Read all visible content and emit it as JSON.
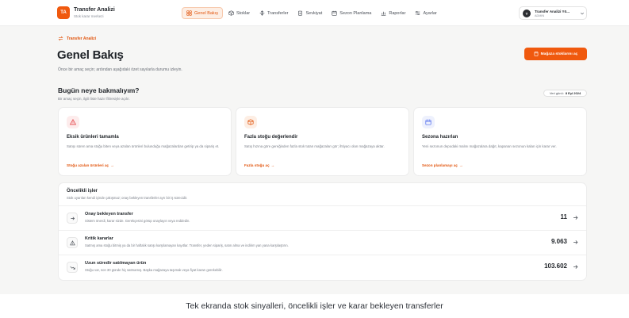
{
  "app": {
    "logo_text": "TA",
    "name": "Transfer Analizi",
    "subtitle": "Stok karar merkezi",
    "accent_color": "#f0590e"
  },
  "nav": [
    {
      "label": "Genel Bakış",
      "icon": "grid-icon",
      "active": true
    },
    {
      "label": "Stoklar",
      "icon": "box-icon",
      "active": false
    },
    {
      "label": "Transferler",
      "icon": "arrows-icon",
      "active": false
    },
    {
      "label": "Sevkiyat",
      "icon": "clipboard-icon",
      "active": false
    },
    {
      "label": "Sezon Planlama",
      "icon": "calendar-icon",
      "active": false
    },
    {
      "label": "Raporlar",
      "icon": "bar-chart-icon",
      "active": false
    },
    {
      "label": "Ayarlar",
      "icon": "sliders-icon",
      "active": false
    }
  ],
  "user": {
    "initial": "T",
    "name": "Transfer Analizi Yö...",
    "role": "ADMIN"
  },
  "header": {
    "breadcrumb": "Transfer Analizi",
    "title": "Genel Bakış",
    "description": "Önce bir amaç seçin; ardından aşağıdaki özet sayılarla durumu izleyin.",
    "primary_button": "Mağaza stoklarını aç"
  },
  "intent": {
    "title": "Bugün neye bakmalıyım?",
    "subtitle": "Bir amaç seçin, ilgili liste hazır filtresiyle açılır.",
    "date_label": "Veri günü:",
    "date_value": "8 Eyl 2024"
  },
  "cards": [
    {
      "title": "Eksik ürünleri tamamla",
      "description": "Satışı süren ama stoğu biten veya azalan ürünleri bulunduğu mağazalardan getirip ya da sipariş et.",
      "link": "Stoğu azalan ürünleri aç",
      "icon": "warning-icon",
      "icon_color": "#e5484d",
      "icon_bg": "#fdecec"
    },
    {
      "title": "Fazla stoğu değerlendir",
      "description": "Satış hızına göre gereğinden fazla stok tutan mağazaları gör; ihtiyacı olan mağazaya aktar.",
      "link": "Fazla stoğu aç",
      "icon": "package-icon",
      "icon_color": "#e2560f",
      "icon_bg": "#fdeee4"
    },
    {
      "title": "Sezona hazırlan",
      "description": "Yeni sezonun depodaki malını mağazalara dağıt, kapanan sezonun kalan için karar ver.",
      "link": "Sezon planlamayı aç",
      "icon": "calendar-icon",
      "icon_color": "#4f6bed",
      "icon_bg": "#eef1fd"
    }
  ],
  "priorities": {
    "title": "Öncelikli işler",
    "subtitle": "Stok uyarıları kendi içinde çakışmaz; onay bekleyen transferler ayrı bir iş sürecidir.",
    "rows": [
      {
        "title": "Onay bekleyen transfer",
        "description": "Sistem önerdi, karar sizde. Gerekçesini görüp onaylayın veya reddedin.",
        "value": "11",
        "icon": "arrow-right-icon"
      },
      {
        "title": "Kritik kararlar",
        "description": "Satmış ama stoğu bitmiş ya da bir haftalık satışı karşılamayan kayıtlar. Transfer, yeden sipariş, satın alma ve indirim yan yana karşılaştırın.",
        "value": "9.063",
        "icon": "alert-triangle-icon"
      },
      {
        "title": "Uzun süredir satılmayan ürün",
        "description": "Stoğu var, son 30 günde hiç satmamış. Başka mağazaya taşımak veya fiyat kararı gerekebilir.",
        "value": "103.602",
        "icon": "trend-down-icon"
      }
    ]
  },
  "caption": "Tek ekranda stok sinyalleri, öncelikli işler ve karar bekleyen transferler"
}
